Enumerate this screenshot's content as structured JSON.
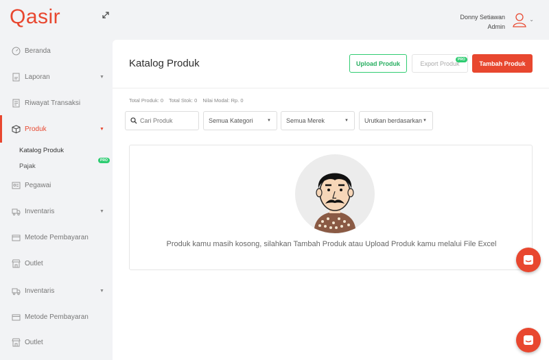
{
  "app": {
    "logo": "Qasir"
  },
  "user": {
    "name": "Donny Setiawan",
    "role": "Admin"
  },
  "sidebar": {
    "items": [
      {
        "label": "Beranda",
        "icon": "dashboard-icon"
      },
      {
        "label": "Laporan",
        "icon": "report-icon",
        "has_arrow": true
      },
      {
        "label": "Riwayat Transaksi",
        "icon": "receipt-icon"
      },
      {
        "label": "Produk",
        "icon": "box-icon",
        "active": true,
        "has_arrow": true
      },
      {
        "label": "Pegawai",
        "icon": "employee-icon"
      },
      {
        "label": "Inventaris",
        "icon": "truck-icon",
        "has_arrow": true
      },
      {
        "label": "Metode Pembayaran",
        "icon": "wallet-icon"
      },
      {
        "label": "Outlet",
        "icon": "store-icon"
      },
      {
        "label": "Inventaris",
        "icon": "truck-icon",
        "has_arrow": true
      },
      {
        "label": "Metode Pembayaran",
        "icon": "wallet-icon"
      },
      {
        "label": "Outlet",
        "icon": "store-icon"
      }
    ],
    "sub_items": [
      {
        "label": "Katalog Produk"
      },
      {
        "label": "Pajak",
        "badge": "PRO"
      }
    ]
  },
  "main": {
    "title": "Katalog Produk",
    "buttons": {
      "upload": "Upload Produk",
      "export": "Export Produk",
      "export_badge": "PRO",
      "tambah": "Tambah Produk"
    },
    "stats": {
      "total_produk": "Total Produk: 0",
      "total_stok": "Total Stok: 0",
      "nilai_modal": "Nilai Modal: Rp. 0"
    },
    "filters": {
      "search_placeholder": "Cari Produk",
      "kategori": "Semua Kategori",
      "merek": "Semua Merek",
      "urutkan": "Urutkan berdasarkan"
    },
    "empty_message": "Produk kamu masih kosong, silahkan Tambah Produk atau Upload Produk kamu melalui File Excel"
  },
  "colors": {
    "brand": "#e8472f",
    "accent_green": "#2ecc71"
  }
}
